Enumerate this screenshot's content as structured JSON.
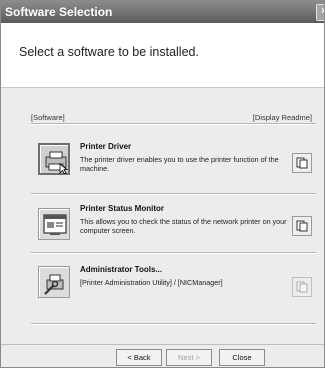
{
  "window": {
    "title": "Software Selection",
    "close_glyph": "×"
  },
  "header": {
    "heading": "Select a software to be installed."
  },
  "columns": {
    "software": "[Software]",
    "readme": "[Display Readme]"
  },
  "items": [
    {
      "title": "Printer Driver",
      "description": "The printer driver enables you to use the printer function of the machine.",
      "icon": "printer-icon",
      "readme_enabled": true
    },
    {
      "title": "Printer Status Monitor",
      "description": "This allows you to check the status of the network printer on your computer screen.",
      "icon": "status-monitor-icon",
      "readme_enabled": true
    },
    {
      "title": "Administrator Tools...",
      "description": "[Printer Administration Utility] / [NICManager]",
      "icon": "admin-tools-icon",
      "readme_enabled": false
    }
  ],
  "footer": {
    "back": "< Back",
    "next": "Next >",
    "close": "Close"
  }
}
